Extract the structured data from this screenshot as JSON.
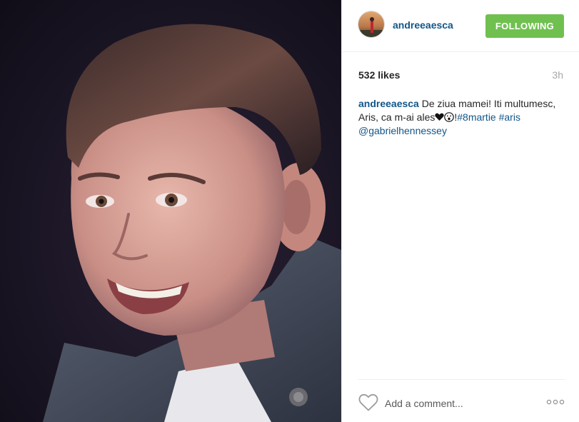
{
  "post": {
    "username": "andreeaesca",
    "follow_label": "FOLLOWING",
    "likes": "532 likes",
    "time": "3h",
    "caption": {
      "username": "andreeaesca",
      "text_before": " De ziua mamei! Iti multumesc, Aris, ca m-ai ales",
      "emoji_after": "!",
      "hashtag1": "#8martie",
      "hashtag2": "#aris",
      "mention": "@gabrielhennessey"
    },
    "comment_placeholder": "Add a comment..."
  },
  "icons": {
    "like": "heart-outline-icon",
    "more": "more-options-icon",
    "caption_heart": "black-heart-emoji",
    "caption_face": "face-emoji"
  },
  "colors": {
    "link": "#125688",
    "follow_button": "#70c050",
    "muted": "#a5a7aa",
    "photo_background": "#15111f"
  }
}
